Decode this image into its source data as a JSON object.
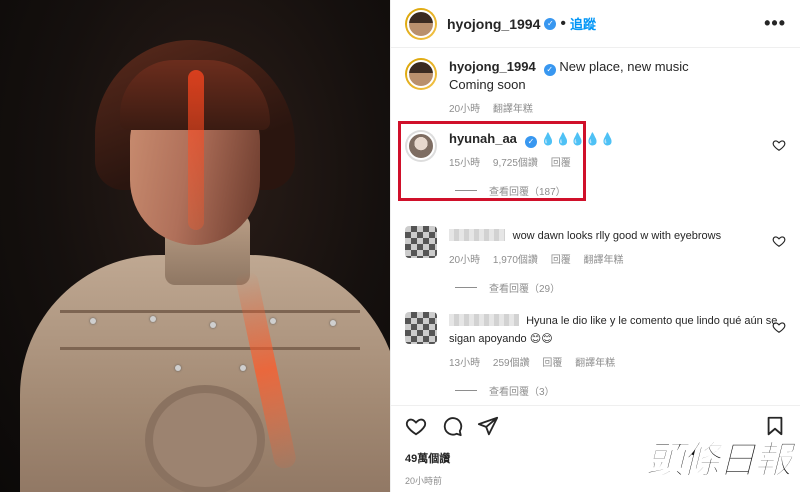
{
  "post": {
    "author": "hyojong_1994",
    "follow_label": "追蹤",
    "more_label": "•••",
    "caption_text": "New place, new music",
    "caption_line2": "Coming soon",
    "caption_time": "20小時",
    "caption_translate": "翻譯年糕"
  },
  "comments": [
    {
      "user": "hyunah_aa",
      "text": "💧💧💧💧💧",
      "time": "15小時",
      "likes": "9,725個讚",
      "reply": "回覆",
      "view_replies": "查看回覆（187）"
    },
    {
      "user": "",
      "text": "wow dawn looks rlly good w with eyebrows",
      "time": "20小時",
      "likes": "1,970個讚",
      "reply": "回覆",
      "translate": "翻譯年糕",
      "view_replies": "查看回覆（29）"
    },
    {
      "user": "",
      "text": "Hyuna le dio like y le comento que lindo qué aún se sigan apoyando 😊😊",
      "time": "13小時",
      "likes": "259個讚",
      "reply": "回覆",
      "translate": "翻譯年糕",
      "view_replies": "查看回覆（3）"
    }
  ],
  "footer": {
    "likes": "49萬個讚",
    "ago": "20小時前"
  },
  "watermark": "頭條日報",
  "colors": {
    "accent": "#0095f6",
    "highlight": "#d0102a",
    "verified": "#3897f0"
  }
}
